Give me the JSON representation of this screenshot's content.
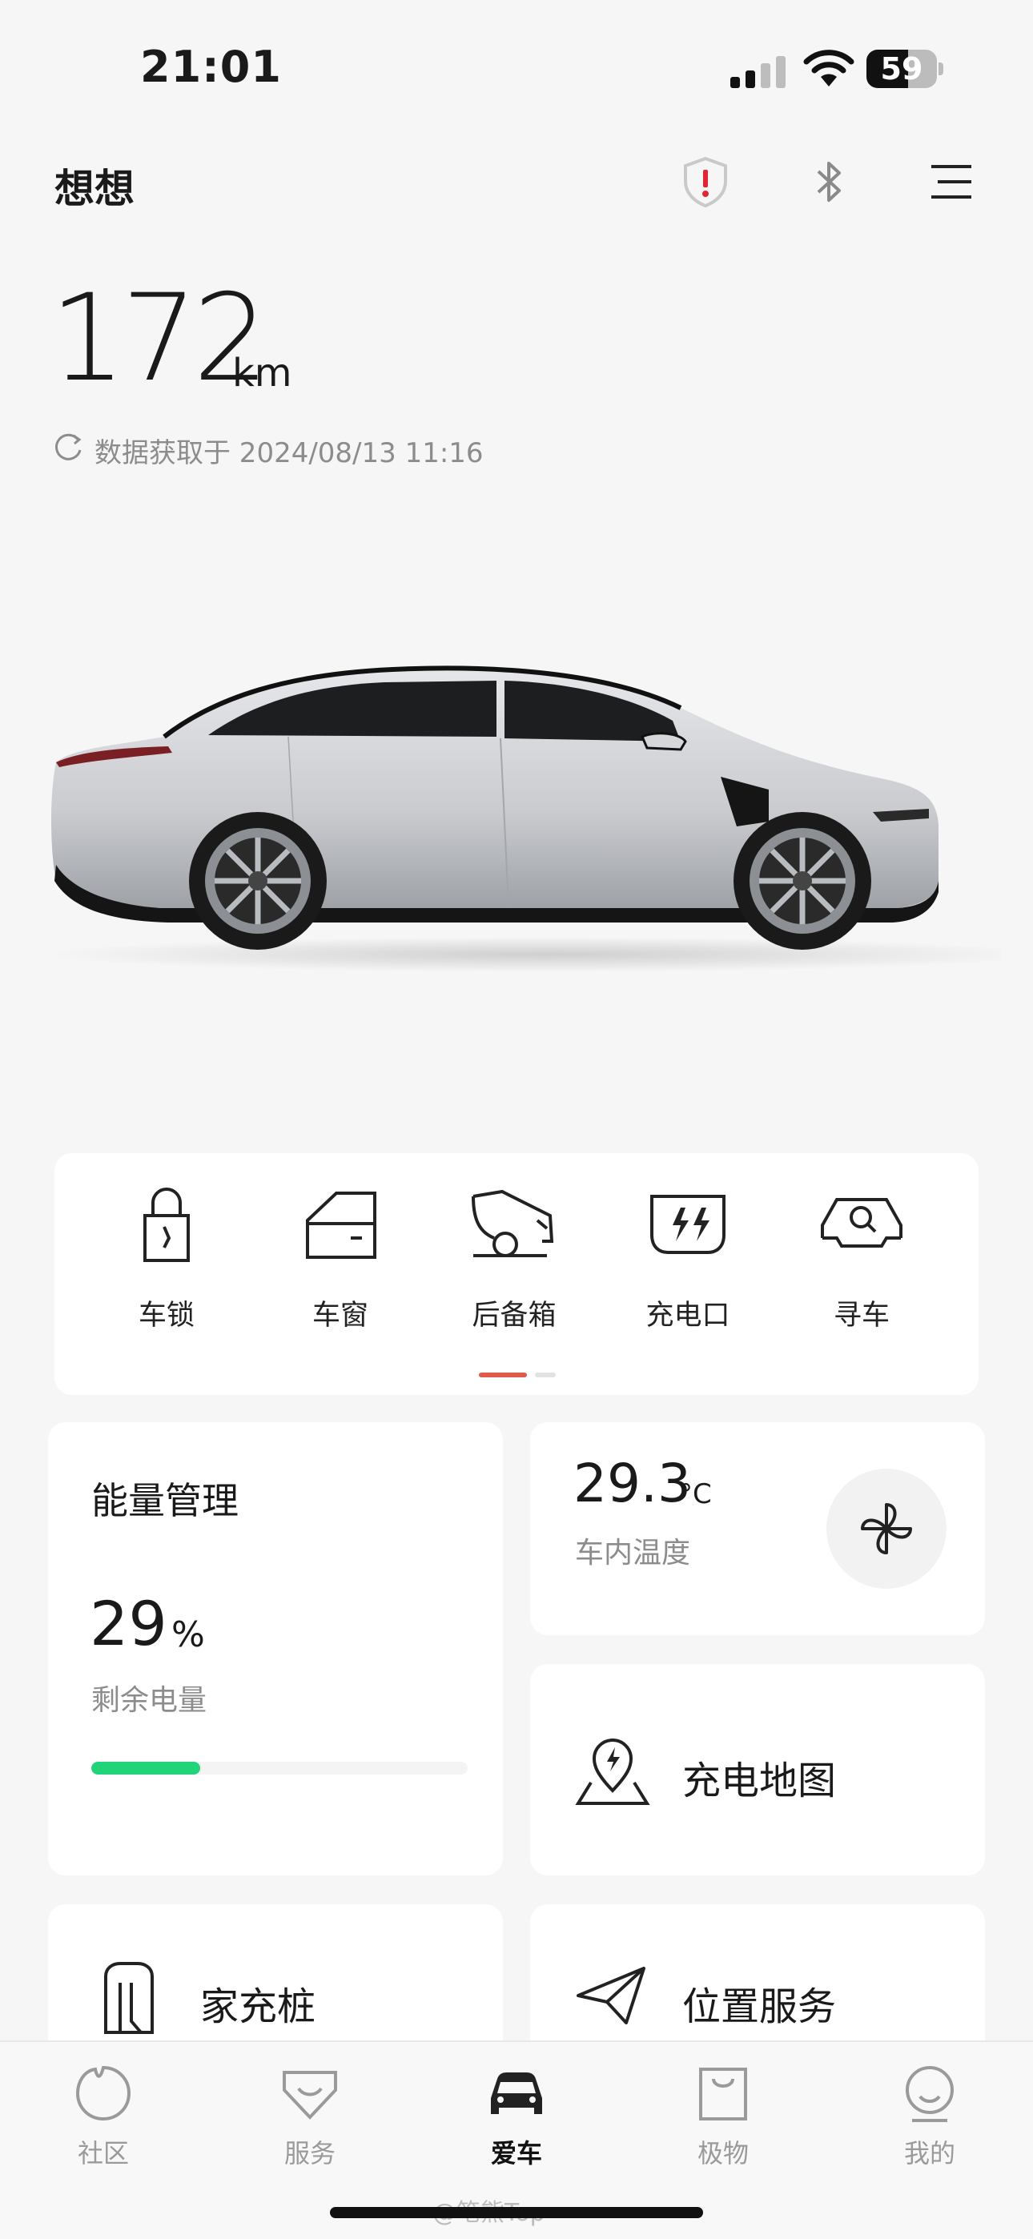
{
  "status_bar": {
    "time": "21:01",
    "battery": "59",
    "battery_level": 0.59
  },
  "header": {
    "car_name": "想想"
  },
  "range": {
    "value": "172",
    "unit": "km",
    "updated_label": "数据获取于 2024/08/13 11:16"
  },
  "quick_controls": [
    {
      "label": "车锁",
      "icon": "lock-icon"
    },
    {
      "label": "车窗",
      "icon": "window-icon"
    },
    {
      "label": "后备箱",
      "icon": "trunk-icon"
    },
    {
      "label": "充电口",
      "icon": "charge-port-icon"
    },
    {
      "label": "寻车",
      "icon": "find-car-icon"
    }
  ],
  "energy": {
    "title": "能量管理",
    "value": "29",
    "unit": "%",
    "sub": "剩余电量",
    "level": 0.29
  },
  "climate": {
    "value": "29.3",
    "unit": "°C",
    "sub": "车内温度"
  },
  "charging_map": {
    "label": "充电地图"
  },
  "home_charger": {
    "label": "家充桩"
  },
  "location_service": {
    "label": "位置服务"
  },
  "tabs": [
    {
      "label": "社区",
      "icon": "community-icon",
      "active": false
    },
    {
      "label": "服务",
      "icon": "service-icon",
      "active": false
    },
    {
      "label": "爱车",
      "icon": "car-icon",
      "active": true
    },
    {
      "label": "极物",
      "icon": "shop-bag-icon",
      "active": false
    },
    {
      "label": "我的",
      "icon": "profile-icon",
      "active": false
    }
  ],
  "watermark": "@笔熊Top",
  "colors": {
    "accent_red": "#e05a4a",
    "battery_green": "#22d37a",
    "background": "#f6f6f6"
  }
}
